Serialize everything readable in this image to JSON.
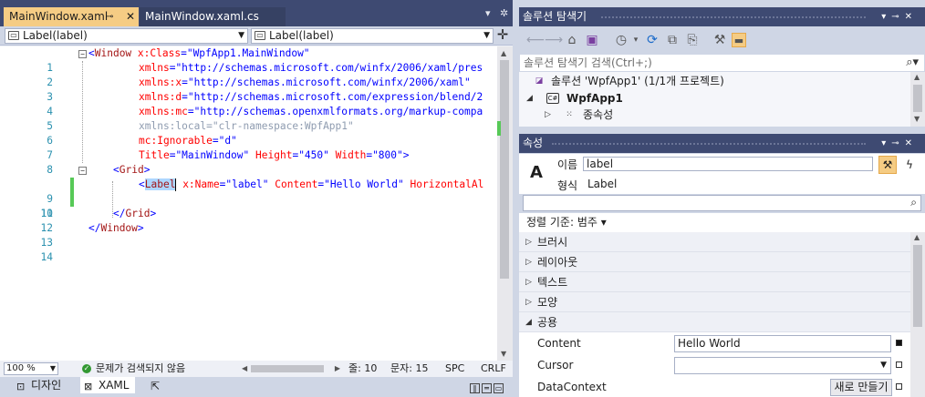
{
  "editor": {
    "tabs": [
      {
        "label": "MainWindow.xaml",
        "active": true
      },
      {
        "label": "MainWindow.xaml.cs",
        "active": false
      }
    ],
    "nav_left": "Label(label)",
    "nav_right": "Label(label)",
    "line_numbers": [
      "1",
      "2",
      "3",
      "4",
      "5",
      "6",
      "7",
      "8",
      "9",
      "10",
      "11",
      "12",
      "13",
      "14"
    ],
    "code": {
      "l1": {
        "open": "<",
        "tag": "Window",
        "attr": "x:Class",
        "eq": "=",
        "val": "\"WpfApp1.MainWindow\""
      },
      "l2": {
        "attr": "xmlns",
        "eq": "=",
        "val": "\"http://schemas.microsoft.com/winfx/2006/xaml/pres"
      },
      "l3": {
        "attr": "xmlns:x",
        "eq": "=",
        "val": "\"http://schemas.microsoft.com/winfx/2006/xaml\""
      },
      "l4": {
        "attr": "xmlns:d",
        "eq": "=",
        "val": "\"http://schemas.microsoft.com/expression/blend/2"
      },
      "l5": {
        "attr": "xmlns:mc",
        "eq": "=",
        "val": "\"http://schemas.openxmlformats.org/markup-compa"
      },
      "l6": {
        "text": "xmlns:local=\"clr-namespace:WpfApp1\""
      },
      "l7": {
        "attr": "mc:Ignorable",
        "eq": "=",
        "val": "\"d\""
      },
      "l8": {
        "attr1": "Title",
        "val1": "\"MainWindow\"",
        "attr2": "Height",
        "val2": "\"450\"",
        "attr3": "Width",
        "val3": "\"800\"",
        "close": ">"
      },
      "l9": {
        "open": "<",
        "tag": "Grid",
        "close": ">"
      },
      "l10": {
        "open": "<",
        "tag": "Label",
        "attr1": "x:Name",
        "val1": "\"label\"",
        "attr2": "Content",
        "val2": "\"Hello World\"",
        "attr3": "HorizontalAl"
      },
      "l12": {
        "open": "</",
        "tag": "Grid",
        "close": ">"
      },
      "l13": {
        "open": "</",
        "tag": "Window",
        "close": ">"
      }
    },
    "status": {
      "zoom": "100 %",
      "issues": "문제가 검색되지 않음",
      "line": "줄: 10",
      "col": "문자: 15",
      "spc": "SPC",
      "crlf": "CRLF"
    },
    "bottom_tabs": {
      "design": "디자인",
      "xaml": "XAML"
    }
  },
  "solution_explorer": {
    "title": "솔루션 탐색기",
    "search_placeholder": "솔루션 탐색기 검색(Ctrl+;)",
    "solution": "솔루션 'WpfApp1' (1/1개 프로젝트)",
    "project": "WpfApp1",
    "dependencies": "종속성"
  },
  "properties": {
    "title": "속성",
    "name_label": "이름",
    "name_value": "label",
    "type_label": "형식",
    "type_value": "Label",
    "sort_by": "정렬 기준: 범주 ▾",
    "categories": [
      "브러시",
      "레이아웃",
      "텍스트",
      "모양",
      "공용"
    ],
    "rows": [
      {
        "name": "Content",
        "value": "Hello World"
      },
      {
        "name": "Cursor",
        "value": ""
      },
      {
        "name": "DataContext",
        "button": "새로 만들기"
      }
    ]
  },
  "colors": {
    "tab_active": "#f5cc84",
    "title_bar": "#3e4a72",
    "keyword_tag": "#a31515",
    "attribute": "#ff0000",
    "value": "#0000ff",
    "line_number": "#2b91af",
    "change_marker": "#57c957"
  }
}
